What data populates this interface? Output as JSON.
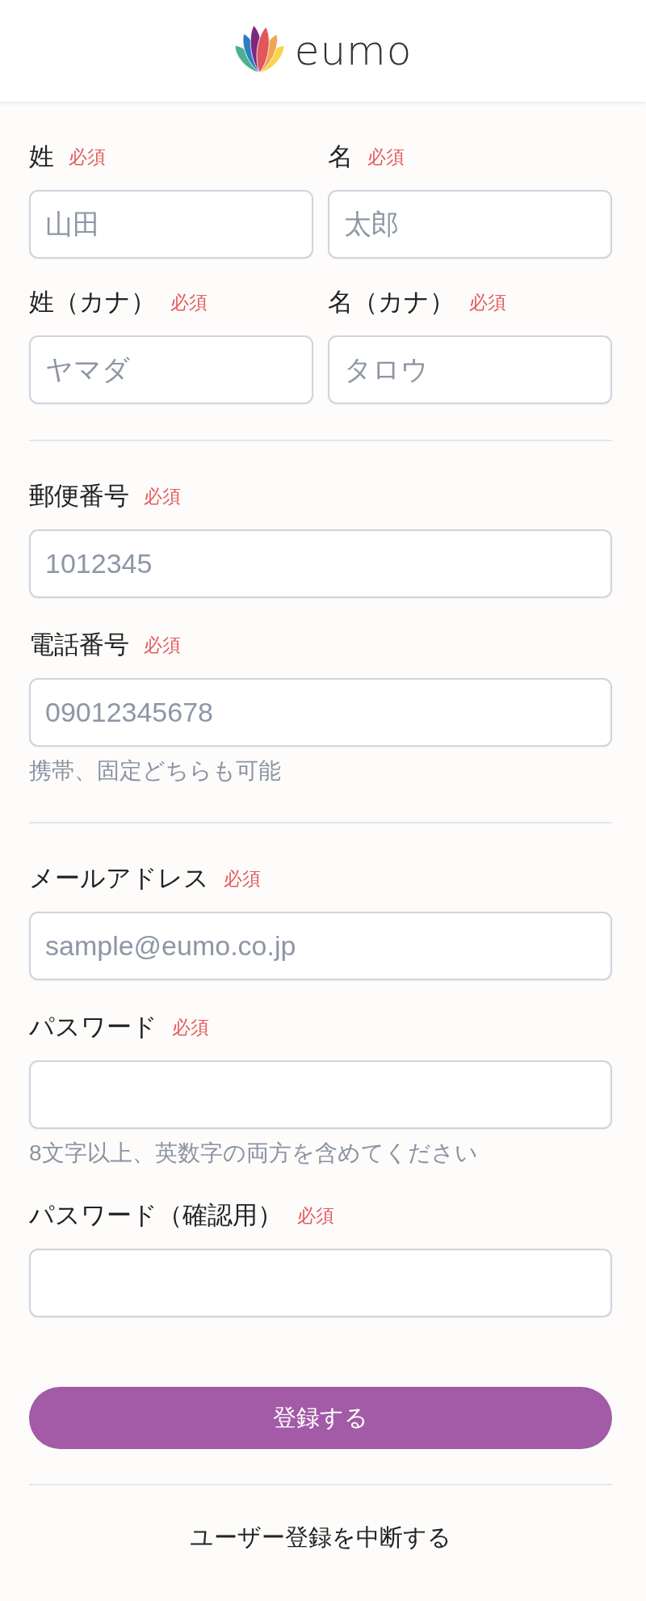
{
  "header": {
    "logo_text": "eumo"
  },
  "sections": [
    {
      "kind": "grid",
      "fields": [
        {
          "label": "姓",
          "required_note": "必須",
          "placeholder": "山田"
        },
        {
          "label": "名",
          "required_note": "必須",
          "placeholder": "太郎"
        },
        {
          "label": "姓（カナ）",
          "required_note": "必須",
          "placeholder": "ヤマダ"
        },
        {
          "label": "名（カナ）",
          "required_note": "必須",
          "placeholder": "タロウ"
        }
      ]
    },
    {
      "kind": "stack",
      "fields": [
        {
          "label": "郵便番号",
          "required_note": "必須",
          "placeholder": "1012345"
        },
        {
          "label": "電話番号",
          "required_note": "必須",
          "placeholder": "09012345678",
          "hint": "携帯、固定どちらも可能"
        }
      ]
    },
    {
      "kind": "stack",
      "fields": [
        {
          "label": "メールアドレス",
          "required_note": "必須",
          "placeholder": "sample@eumo.co.jp"
        },
        {
          "label": "パスワード",
          "required_note": "必須",
          "hint": "8文字以上、英数字の両方を含めてください"
        },
        {
          "label": "パスワード（確認用）",
          "required_note": "必須"
        }
      ]
    }
  ],
  "submit_button": {
    "label": "登録する"
  },
  "cancel_link": {
    "label": "ユーザー登録を中断する"
  }
}
